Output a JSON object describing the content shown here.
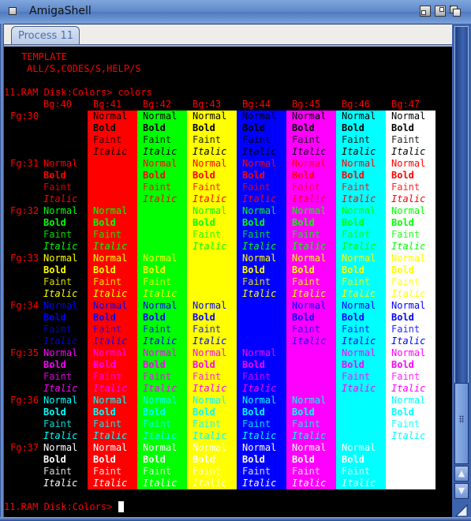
{
  "window": {
    "title": "AmigaShell",
    "tab_label": "Process 11"
  },
  "console": {
    "template_header": "TEMPLATE",
    "template_args": "ALL/S,CODES/S,HELP/S",
    "prompt_command": "11.RAM Disk:Colors> colors",
    "prompt_current": "11.RAM Disk:Colors> ",
    "styles": [
      "Normal",
      "Bold",
      "Faint",
      "Italic"
    ],
    "bg_columns": [
      {
        "label": "Bg:40",
        "color": "#000000"
      },
      {
        "label": "Bg:41",
        "color": "#ff0000"
      },
      {
        "label": "Bg:42",
        "color": "#00ff00"
      },
      {
        "label": "Bg:43",
        "color": "#ffff00"
      },
      {
        "label": "Bg:44",
        "color": "#0000ff"
      },
      {
        "label": "Bg:45",
        "color": "#ff00ff"
      },
      {
        "label": "Bg:46",
        "color": "#00ffff"
      },
      {
        "label": "Bg:47",
        "color": "#ffffff"
      }
    ],
    "fg_rows": [
      {
        "label": "Fg:30",
        "color": "#000000"
      },
      {
        "label": "Fg:31",
        "color": "#ff0000"
      },
      {
        "label": "Fg:32",
        "color": "#00ff00"
      },
      {
        "label": "Fg:33",
        "color": "#ffff00"
      },
      {
        "label": "Fg:34",
        "color": "#0000ff"
      },
      {
        "label": "Fg:35",
        "color": "#ff00ff"
      },
      {
        "label": "Fg:36",
        "color": "#00ffff"
      },
      {
        "label": "Fg:37",
        "color": "#ffffff"
      }
    ],
    "text_color": "#ff0000",
    "background": "#000000"
  },
  "scrollbar": {
    "position_fraction": 0.82
  }
}
